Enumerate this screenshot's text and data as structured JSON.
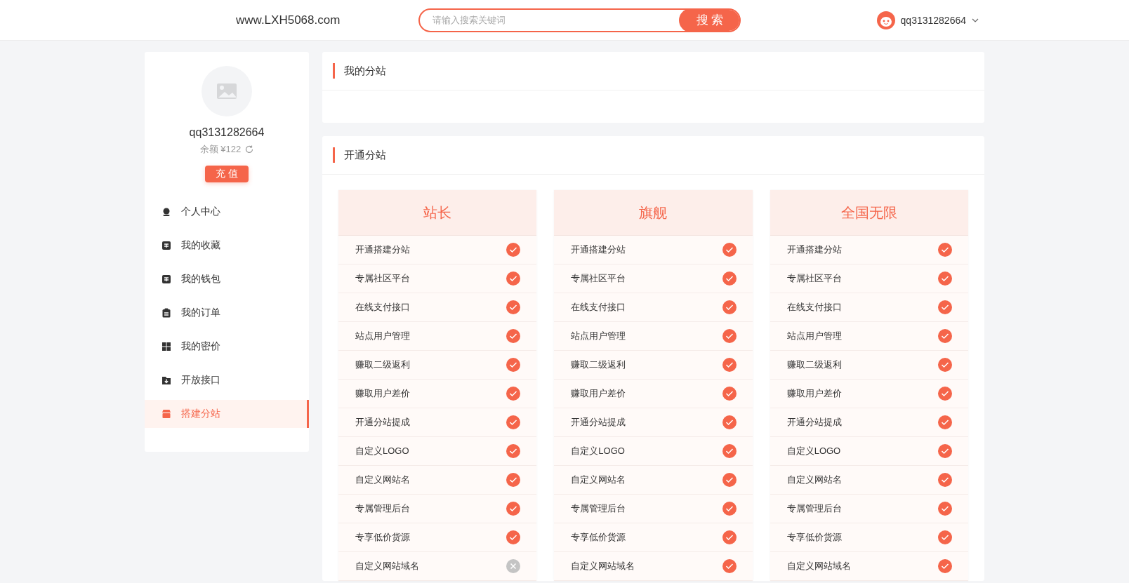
{
  "header": {
    "site_name": "www.LXH5068.com",
    "search": {
      "placeholder": "请输入搜索关键词",
      "button": "搜 索"
    },
    "user": {
      "name": "qq3131282664"
    }
  },
  "sidebar": {
    "username": "qq3131282664",
    "balance": "余额 ¥122",
    "recharge_button": "充 值",
    "items": [
      {
        "label": "个人中心",
        "kind": "user",
        "selected": false
      },
      {
        "label": "我的收藏",
        "kind": "note",
        "selected": false
      },
      {
        "label": "我的钱包",
        "kind": "wallet",
        "selected": false
      },
      {
        "label": "我的订单",
        "kind": "clipboard",
        "selected": false
      },
      {
        "label": "我的密价",
        "kind": "grid",
        "selected": false
      },
      {
        "label": "开放接口",
        "kind": "folder",
        "selected": false
      },
      {
        "label": "搭建分站",
        "kind": "store",
        "selected": true
      }
    ]
  },
  "my_substation": {
    "title": "我的分站"
  },
  "open_substation": {
    "title": "开通分站",
    "plans": [
      {
        "name": "站长",
        "features": [
          {
            "label": "开通搭建分站",
            "included": true
          },
          {
            "label": "专属社区平台",
            "included": true
          },
          {
            "label": "在线支付接口",
            "included": true
          },
          {
            "label": "站点用户管理",
            "included": true
          },
          {
            "label": "赚取二级返利",
            "included": true
          },
          {
            "label": "赚取用户差价",
            "included": true
          },
          {
            "label": "开通分站提成",
            "included": true
          },
          {
            "label": "自定义LOGO",
            "included": true
          },
          {
            "label": "自定义网站名",
            "included": true
          },
          {
            "label": "专属管理后台",
            "included": true
          },
          {
            "label": "专享低价货源",
            "included": true
          },
          {
            "label": "自定义网站域名",
            "included": false
          }
        ]
      },
      {
        "name": "旗舰",
        "features": [
          {
            "label": "开通搭建分站",
            "included": true
          },
          {
            "label": "专属社区平台",
            "included": true
          },
          {
            "label": "在线支付接口",
            "included": true
          },
          {
            "label": "站点用户管理",
            "included": true
          },
          {
            "label": "赚取二级返利",
            "included": true
          },
          {
            "label": "赚取用户差价",
            "included": true
          },
          {
            "label": "开通分站提成",
            "included": true
          },
          {
            "label": "自定义LOGO",
            "included": true
          },
          {
            "label": "自定义网站名",
            "included": true
          },
          {
            "label": "专属管理后台",
            "included": true
          },
          {
            "label": "专享低价货源",
            "included": true
          },
          {
            "label": "自定义网站域名",
            "included": true
          }
        ]
      },
      {
        "name": "全国无限",
        "features": [
          {
            "label": "开通搭建分站",
            "included": true
          },
          {
            "label": "专属社区平台",
            "included": true
          },
          {
            "label": "在线支付接口",
            "included": true
          },
          {
            "label": "站点用户管理",
            "included": true
          },
          {
            "label": "赚取二级返利",
            "included": true
          },
          {
            "label": "赚取用户差价",
            "included": true
          },
          {
            "label": "开通分站提成",
            "included": true
          },
          {
            "label": "自定义LOGO",
            "included": true
          },
          {
            "label": "自定义网站名",
            "included": true
          },
          {
            "label": "专属管理后台",
            "included": true
          },
          {
            "label": "专享低价货源",
            "included": true
          },
          {
            "label": "自定义网站域名",
            "included": true
          }
        ]
      }
    ]
  }
}
